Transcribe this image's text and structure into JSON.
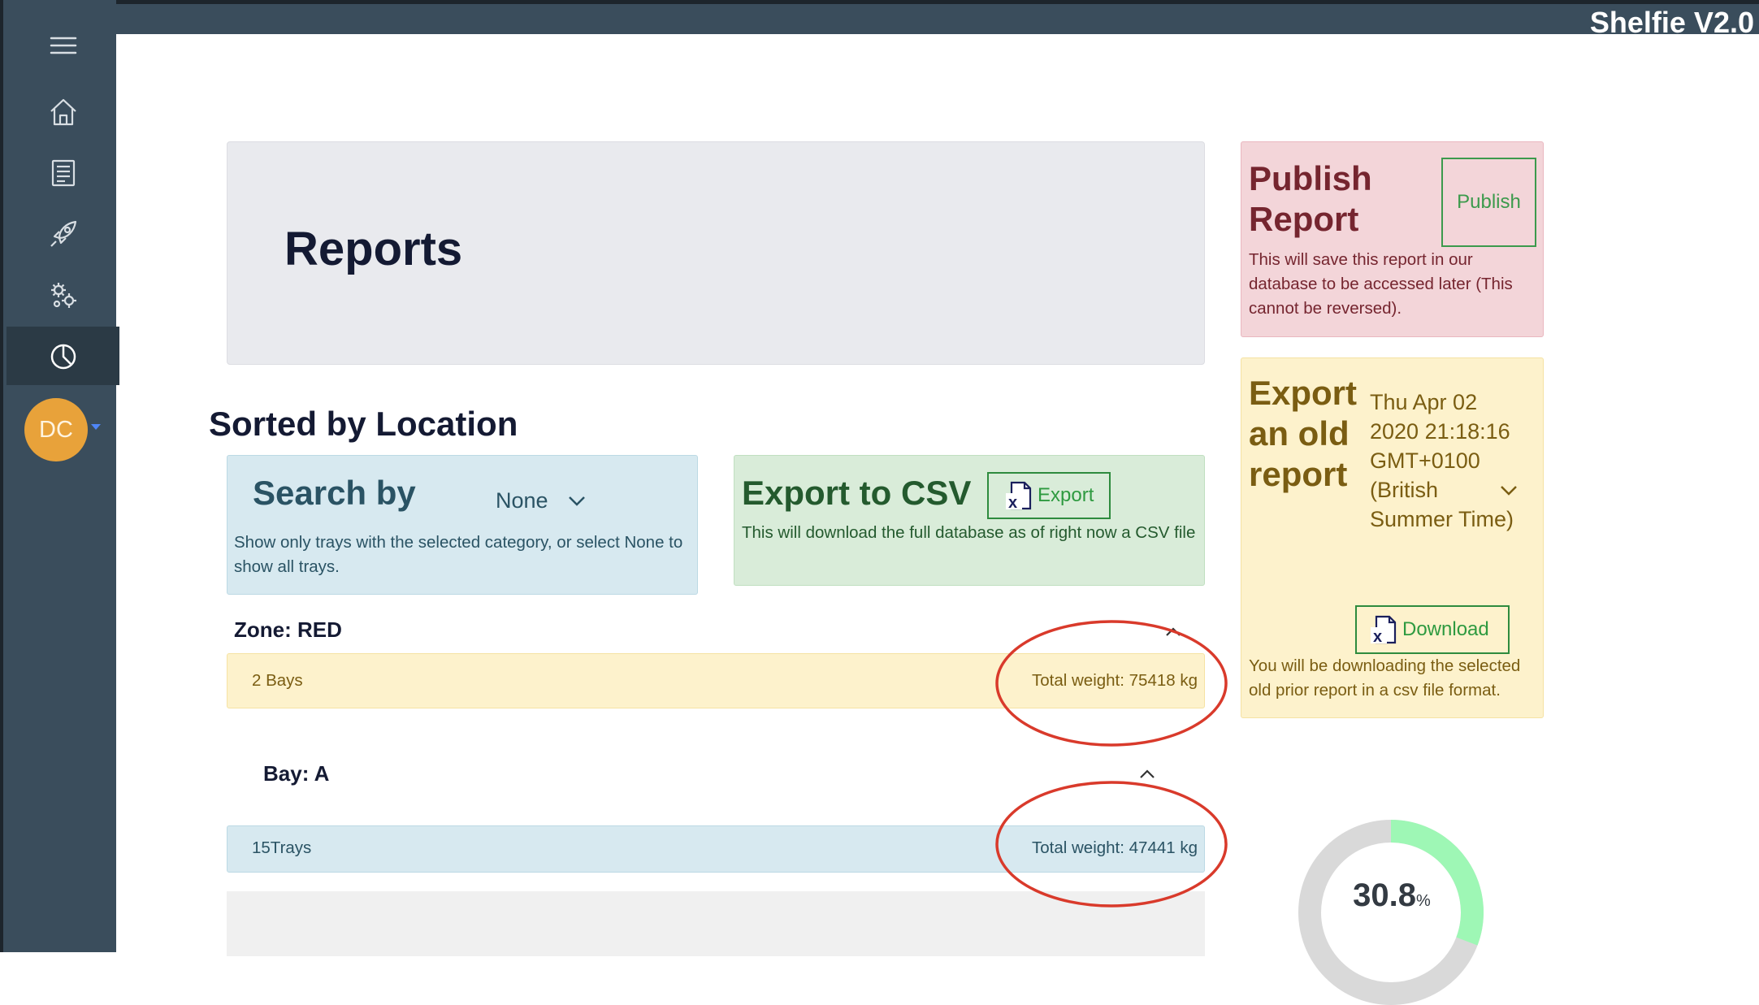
{
  "app": {
    "title": "Shelfie V2.0"
  },
  "sidebar": {
    "items": [
      {
        "icon": "menu-icon"
      },
      {
        "icon": "home-icon"
      },
      {
        "icon": "document-icon"
      },
      {
        "icon": "rocket-icon"
      },
      {
        "icon": "gears-icon"
      },
      {
        "icon": "pie-chart-icon",
        "active": true
      }
    ],
    "avatar_initials": "DC"
  },
  "header": {
    "title": "Reports"
  },
  "section": {
    "title": "Sorted by Location"
  },
  "search": {
    "title": "Search by",
    "selected": "None",
    "description": "Show only trays with the selected category, or select None to show all trays."
  },
  "csv": {
    "title": "Export to CSV",
    "button_label": "Export",
    "description": "This will download the full database as of right now a CSV file"
  },
  "publish": {
    "title": "Publish Report",
    "button_label": "Publish",
    "description": "This will save this report in our database to be accessed later (This cannot be reversed)."
  },
  "old_report": {
    "title": "Export an old report",
    "selected": "Thu Apr 02 2020 21:18:16 GMT+0100 (British Summer Time)",
    "button_label": "Download",
    "description": "You will be downloading the selected old prior report in a csv file format."
  },
  "zone": {
    "label": "Zone: RED",
    "summary_left": "2 Bays",
    "summary_right": "Total weight: 75418 kg"
  },
  "bay": {
    "label": "Bay: A",
    "summary_left": "15Trays",
    "summary_right": "Total weight: 47441 kg"
  },
  "gauge": {
    "value": "30.8",
    "unit": "%",
    "fraction": 0.308,
    "fill_color": "#9ef7b5",
    "track_color": "#d9d9d9"
  },
  "colors": {
    "annotation": "#d93a2b",
    "sidebar": "#3a4d5c"
  }
}
